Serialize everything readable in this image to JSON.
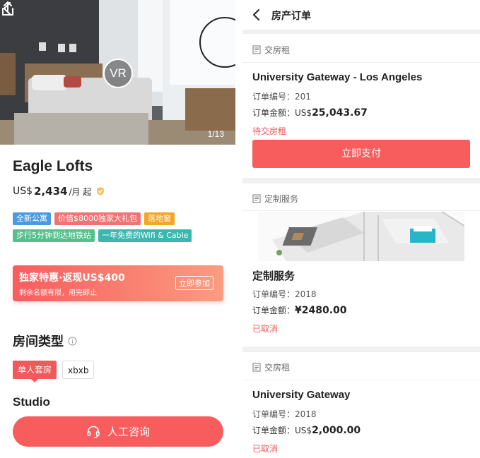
{
  "listing": {
    "photo_counter": "1/13",
    "vr_label": "VR",
    "title": "Eagle Lofts",
    "price_prefix": "US$",
    "price_amount": "2,434",
    "price_unit": "/月 起",
    "tags_row1": [
      {
        "label": "全新公寓",
        "color": "#4b9be0"
      },
      {
        "label": "价值$8000独家大礼包",
        "color": "#f27373"
      },
      {
        "label": "落地窗",
        "color": "#f5a623"
      }
    ],
    "tags_row2": [
      {
        "label": "步行5分钟到达地铁站",
        "color": "#56c08d"
      },
      {
        "label": "一年免费的Wifi & Cable",
        "color": "#3ab8b0"
      }
    ],
    "promo": {
      "title": "独家特惠·返现US$400",
      "subtitle": "剩余名额有限，用完即止",
      "button": "立即参加"
    },
    "room_type_heading": "房间类型",
    "room_tabs": [
      "单人套房",
      "xbxb"
    ],
    "room_name": "Studio",
    "consult_button": "人工咨询"
  },
  "orders": {
    "page_title": "房产订单",
    "items": [
      {
        "section": "交房租",
        "title": "University Gateway - Los Angeles",
        "number_label": "订单编号：",
        "number": "201",
        "amount_label": "订单金额：",
        "currency": "US$",
        "amount": "25,043.67",
        "status": "待交房租",
        "pay_button": "立即支付"
      },
      {
        "section": "定制服务",
        "title": "定制服务",
        "number_label": "订单编号：",
        "number": "2018",
        "amount_label": "订单金额：",
        "currency": "¥",
        "amount": "2480.00",
        "status": "已取消"
      },
      {
        "section": "交房租",
        "title": "University Gateway",
        "number_label": "订单编号：",
        "number": "2018",
        "amount_label": "订单金额：",
        "currency": "US$",
        "amount": "2,000.00",
        "status": "已取消"
      }
    ]
  },
  "colors": {
    "accent": "#f75d5d",
    "status_red": "#f05a5a"
  }
}
